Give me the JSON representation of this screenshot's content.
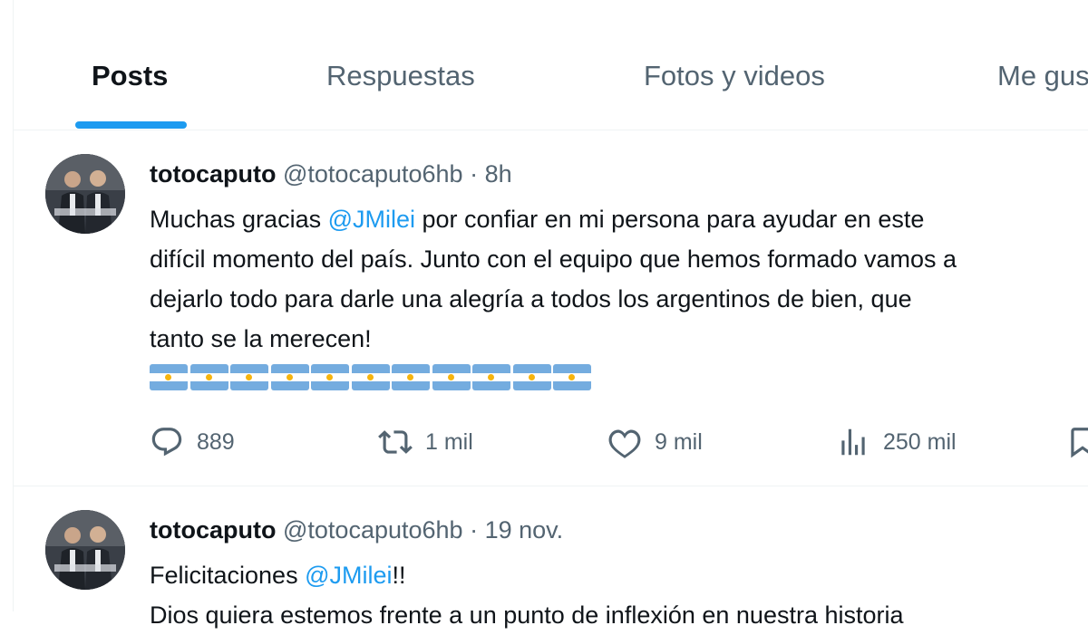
{
  "tabs": [
    {
      "label": "Posts",
      "active": true
    },
    {
      "label": "Respuestas"
    },
    {
      "label": "Fotos y videos"
    },
    {
      "label": "Me gusta"
    }
  ],
  "tweets": [
    {
      "name": "totocaputo",
      "handle": "@totocaputo6hb",
      "separator": "·",
      "time": "8h",
      "text_parts": {
        "t1": "Muchas gracias ",
        "mention": "@JMilei",
        "t2": " por confiar en mi persona para ayudar en este",
        "line2": "difícil momento del país. Junto con el equipo que hemos formado vamos a",
        "line3": "dejarlo todo para darle una alegría a todos los argentinos de bien, que",
        "line4": "tanto se la merecen!"
      },
      "flag_emoji_count": 11,
      "stats": {
        "replies": "889",
        "reposts": "1 mil",
        "likes": "9 mil",
        "views": "250 mil"
      }
    },
    {
      "name": "totocaputo",
      "handle": "@totocaputo6hb",
      "separator": "·",
      "time": "19 nov.",
      "text_parts": {
        "t1": "Felicitaciones ",
        "mention": "@JMilei",
        "t2": "!!",
        "line2": "Dios quiera estemos frente a un punto de inflexión en nuestra historia"
      }
    }
  ],
  "icons": {
    "reply": "reply-icon",
    "repost": "repost-icon",
    "like": "heart-icon",
    "views": "views-icon",
    "bookmark": "bookmark-icon"
  },
  "colors": {
    "accent": "#1d9bf0",
    "text": "#0f1419",
    "muted": "#536471",
    "border": "#eff3f4",
    "flag_blue": "#74acdf",
    "flag_sun": "#f6b40e"
  }
}
